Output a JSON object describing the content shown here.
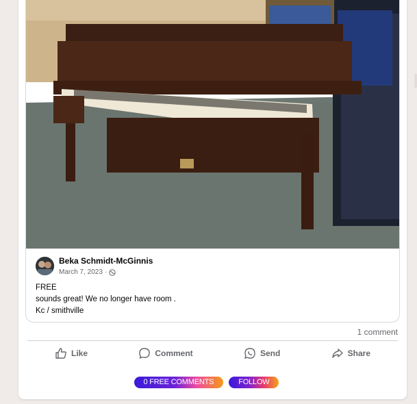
{
  "post": {
    "author": "Beka Schmidt-McGinnis",
    "date": "March 7, 2023",
    "separator": "·",
    "privacy_icon": "globe-icon",
    "text_lines": [
      "FREE",
      "sounds great! We no longer have room .",
      "Kc / smithville"
    ]
  },
  "stats": {
    "comments": "1 comment"
  },
  "actions": {
    "like": "Like",
    "comment": "Comment",
    "send": "Send",
    "share": "Share"
  },
  "pills": {
    "free_comments": "0 FREE COMMENTS",
    "follow": "FOLLOW"
  },
  "colors": {
    "text_primary": "#050505",
    "text_secondary": "#65676b",
    "divider": "#ced0d4",
    "page_bg": "#f0ebe9"
  }
}
